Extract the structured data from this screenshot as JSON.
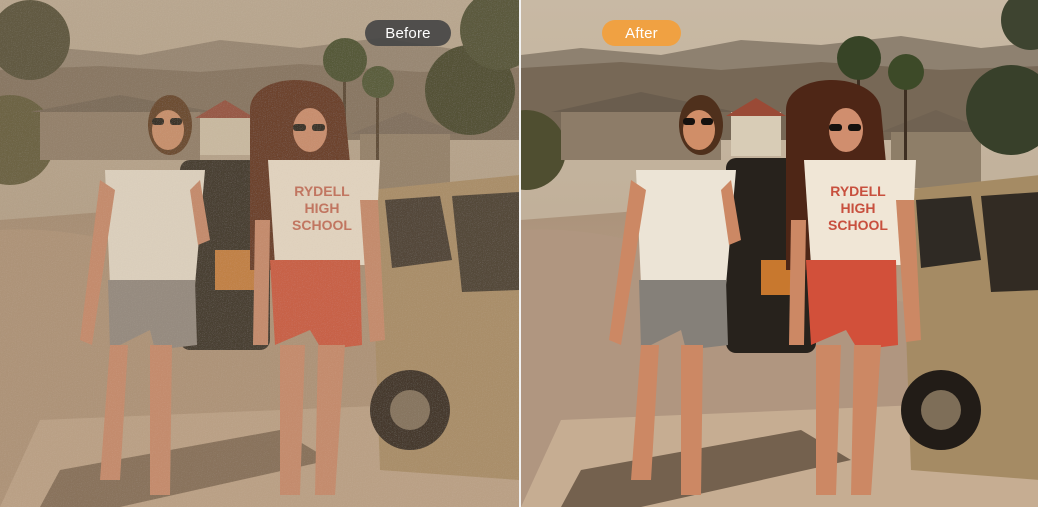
{
  "labels": {
    "before": "Before",
    "after": "After"
  },
  "badge_colors": {
    "before": "#464646",
    "after": "#f0a142"
  },
  "shirt_text": [
    "RYDELL",
    "HIGH",
    "SCHOOL"
  ]
}
